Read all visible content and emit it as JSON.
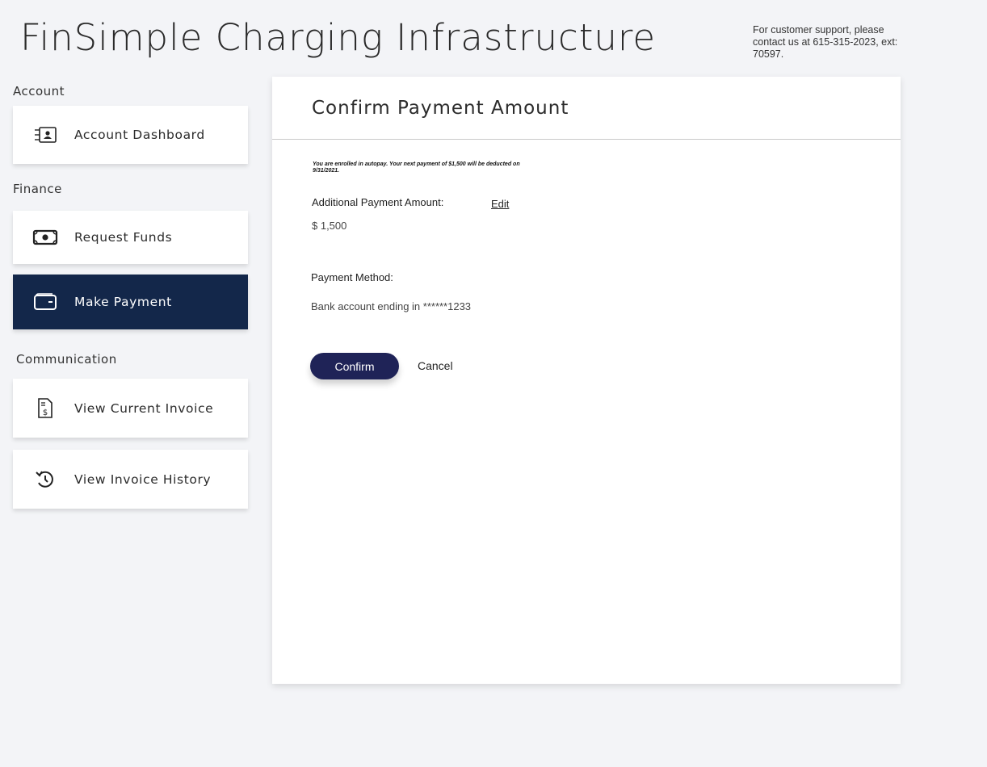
{
  "header": {
    "title": "FinSimple Charging Infrastructure",
    "support_text": "For customer support, please contact us at 615-315-2023, ext: 70597."
  },
  "sidebar": {
    "sections": [
      {
        "label": "Account"
      },
      {
        "label": "Finance"
      },
      {
        "label": "Communication"
      }
    ],
    "items": [
      {
        "label": "Account Dashboard",
        "icon": "id-card-icon"
      },
      {
        "label": "Request Funds",
        "icon": "cash-icon"
      },
      {
        "label": "Make Payment",
        "icon": "wallet-icon",
        "active": true
      },
      {
        "label": "View Current Invoice",
        "icon": "invoice-icon"
      },
      {
        "label": "View Invoice History",
        "icon": "history-icon"
      }
    ]
  },
  "main": {
    "title": "Confirm Payment Amount",
    "autopay_notice": "You are enrolled in autopay. Your next payment of $1,500 will be deducted on 9/31/2021.",
    "amount_label": "Additional Payment Amount:",
    "edit_label": "Edit",
    "amount_value": "$  1,500",
    "method_label": "Payment Method:",
    "method_value": "Bank account ending in ******1233",
    "confirm_label": "Confirm",
    "cancel_label": "Cancel"
  },
  "colors": {
    "active_nav": "#13274a",
    "confirm_button": "#1f2357",
    "background": "#f3f4f7"
  }
}
